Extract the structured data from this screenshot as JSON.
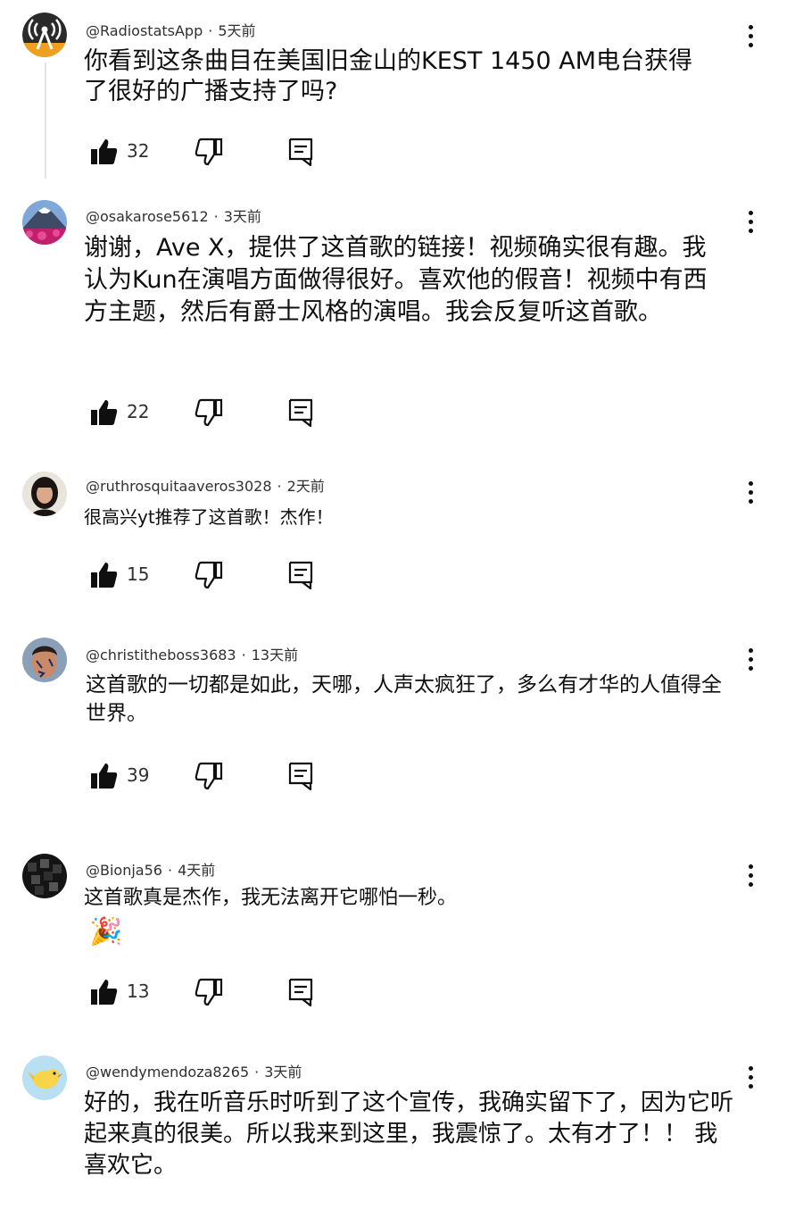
{
  "comments": [
    {
      "handle": "@RadiostatsApp",
      "time": "5天前",
      "text": "你看到这条曲目在美国旧金山的KEST 1450 AM电台获得了很好的广播支持了吗?",
      "likes": "32",
      "avatar": "radio-tower-logo"
    },
    {
      "handle": "@osakarose5612",
      "time": "3天前",
      "text": "谢谢，Ave X，提供了这首歌的链接！视频确实很有趣。我认为Kun在演唱方面做得很好。喜欢他的假音！视频中有西方主题，然后有爵士风格的演唱。我会反复听这首歌。",
      "likes": "22",
      "avatar": "mountain-flowers-photo"
    },
    {
      "handle": "@ruthrosquitaaveros3028",
      "time": "2天前",
      "text": "很高兴yt推荐了这首歌！杰作！",
      "likes": "15",
      "avatar": "woman-portrait"
    },
    {
      "handle": "@christitheboss3683",
      "time": "13天前",
      "text": "这首歌的一切都是如此，天哪，人声太疯狂了，多么有才华的人值得全世界。",
      "likes": "39",
      "avatar": "face-paint-portrait"
    },
    {
      "handle": "@Bionja56",
      "time": "4天前",
      "text": "这首歌真是杰作，我无法离开它哪怕一秒。",
      "emoji": "🎉",
      "likes": "13",
      "avatar": "dark-cubes-image"
    },
    {
      "handle": "@wendymendoza8265",
      "time": "3天前",
      "text": "好的，我在听音乐时听到了这个宣传，我确实留下了，因为它听起来真的很美。所以我来到这里，我震惊了。太有才了！！ 我喜欢它。",
      "avatar": "yellow-bird-cartoon"
    }
  ],
  "icons": {
    "like": "thumb-up-icon",
    "dislike": "thumb-down-icon",
    "reply": "reply-icon",
    "menu": "more-vert-icon"
  },
  "colors": {
    "text": "#0f0f0f",
    "meta": "#303030",
    "thread_line": "#e2e2e2"
  }
}
